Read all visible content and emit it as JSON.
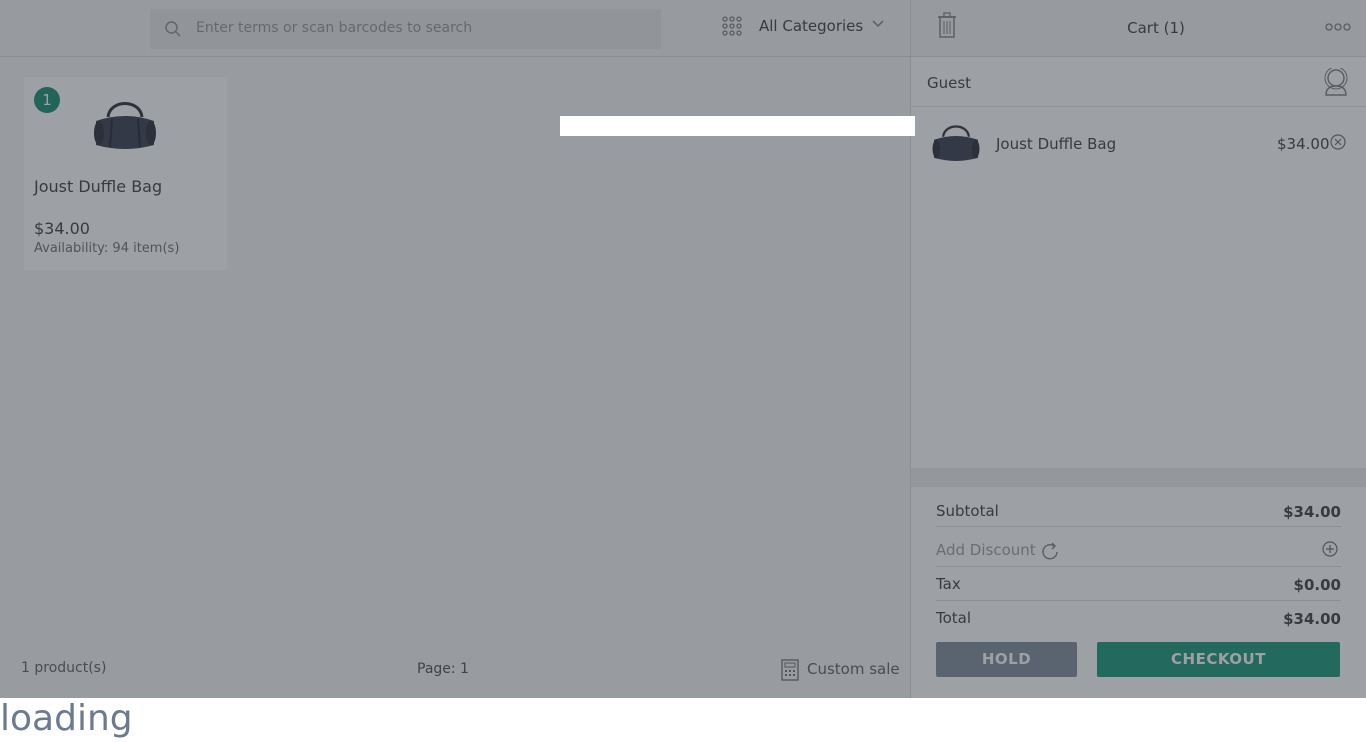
{
  "search": {
    "placeholder": "Enter terms or scan barcodes to search"
  },
  "categories": {
    "selected": "All Categories"
  },
  "products": [
    {
      "badge": "1",
      "name": "Joust Duffle Bag",
      "price": "$34.00",
      "availability": "Availability: 94 item(s)"
    }
  ],
  "footer": {
    "count": "1 product(s)",
    "page": "Page: 1",
    "custom_sale": "Custom sale"
  },
  "cart": {
    "title": "Cart (1)",
    "customer": "Guest",
    "items": [
      {
        "name": "Joust Duffle Bag",
        "price": "$34.00"
      }
    ],
    "subtotal_label": "Subtotal",
    "subtotal": "$34.00",
    "discount_label": "Add Discount",
    "tax_label": "Tax",
    "tax": "$0.00",
    "total_label": "Total",
    "total": "$34.00",
    "hold_label": "HOLD",
    "checkout_label": "CHECKOUT"
  },
  "status": {
    "loading": "loading"
  },
  "colors": {
    "accent": "#09856a",
    "hold": "#798496",
    "overlay": "#3c424a"
  }
}
